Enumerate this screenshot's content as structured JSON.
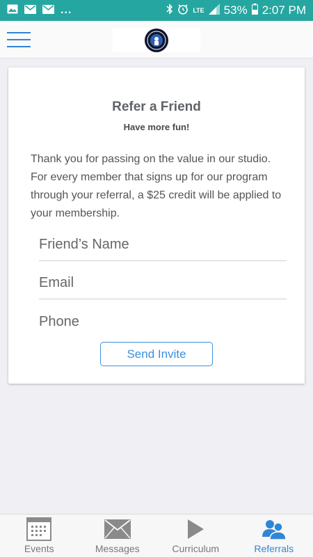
{
  "status_bar": {
    "dots": "...",
    "network": "LTE",
    "battery": "53%",
    "time": "2:07 PM",
    "icons": [
      "image-icon",
      "mail-icon",
      "mail-icon",
      "bluetooth-icon",
      "alarm-icon",
      "signal-icon",
      "battery-icon"
    ]
  },
  "header": {
    "menu_icon": "hamburger-menu-icon",
    "logo": "studio-logo"
  },
  "card": {
    "title": "Refer a Friend",
    "subtitle": "Have more fun!",
    "body": "Thank you for passing on the value in our studio. For every member that signs up for our program through your referral, a $25 credit will be applied to your membership.",
    "fields": {
      "name_placeholder": "Friend’s Name",
      "email_placeholder": "Email",
      "phone_placeholder": "Phone"
    },
    "send_label": "Send Invite"
  },
  "bottom_nav": {
    "items": [
      {
        "label": "Events",
        "icon": "calendar-icon"
      },
      {
        "label": "Messages",
        "icon": "envelope-icon"
      },
      {
        "label": "Curriculum",
        "icon": "play-icon"
      },
      {
        "label": "Referrals",
        "icon": "users-icon"
      }
    ],
    "active": "Referrals"
  },
  "colors": {
    "status_bar": "#26a6a0",
    "accent": "#2f86d6",
    "background": "#efeff4"
  }
}
